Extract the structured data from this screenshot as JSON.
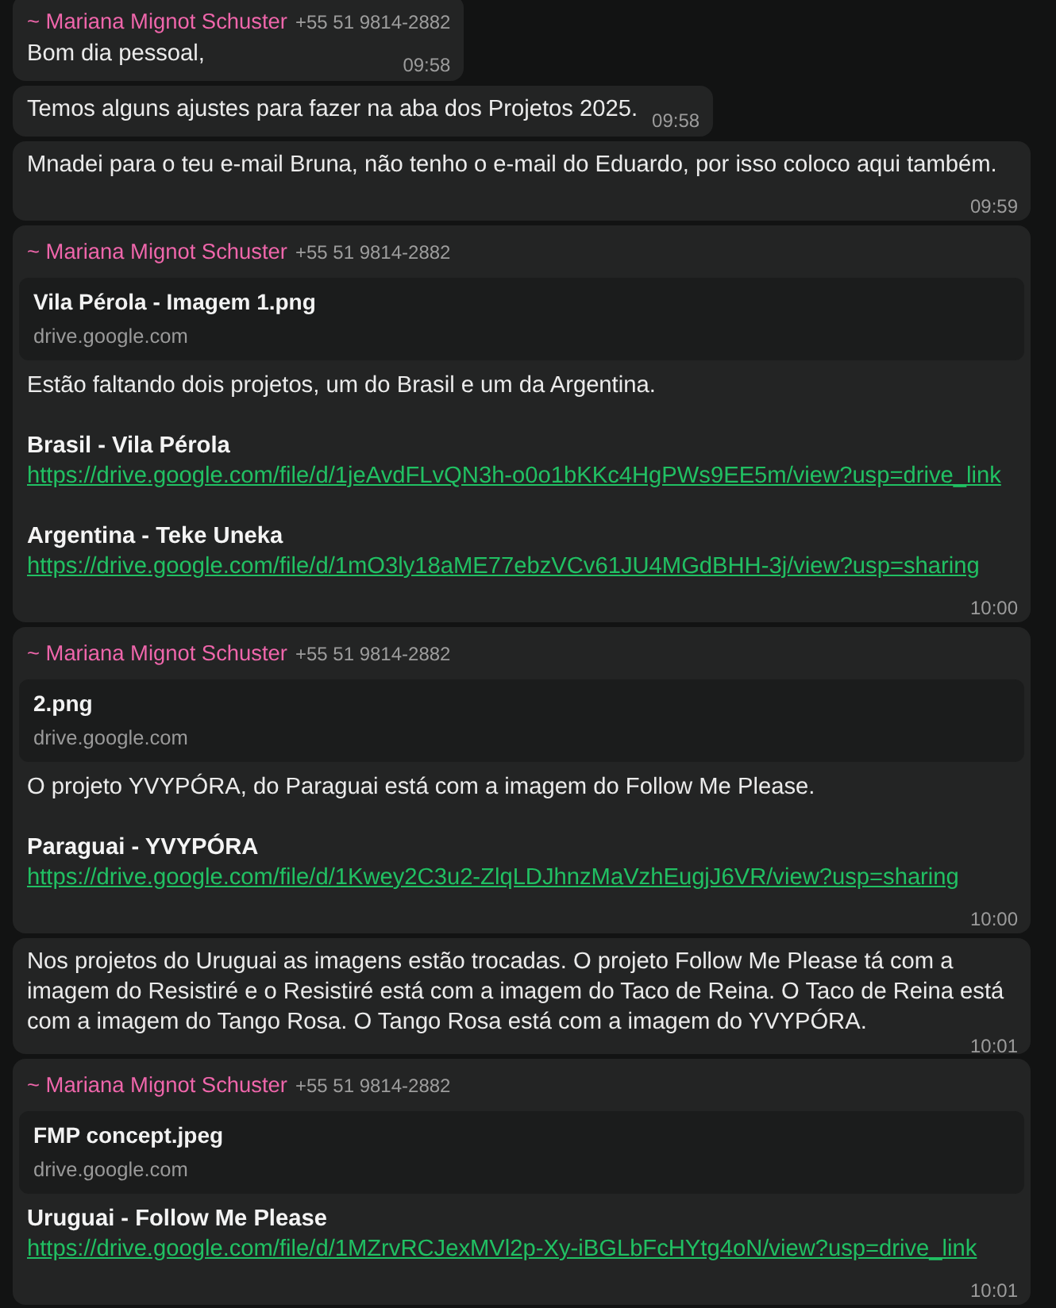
{
  "chat": {
    "messages": [
      {
        "sender": {
          "name": "~ Mariana Mignot Schuster",
          "phone": "+55 51 9814-2882"
        },
        "blocks": [
          {
            "kind": "paragraph",
            "text": "Bom dia pessoal,"
          }
        ],
        "time": "09:58"
      },
      {
        "blocks": [
          {
            "kind": "paragraph",
            "text": "Temos alguns ajustes para fazer na aba dos Projetos 2025."
          }
        ],
        "time": "09:58"
      },
      {
        "blocks": [
          {
            "kind": "paragraph",
            "text": "Mnadei para o teu e-mail Bruna, não tenho o e-mail do Eduardo, por isso coloco aqui também."
          }
        ],
        "time": "09:59"
      },
      {
        "sender": {
          "name": "~ Mariana Mignot Schuster",
          "phone": "+55 51 9814-2882"
        },
        "blocks": [
          {
            "kind": "preview",
            "title": "Vila Pérola - Imagem 1.png",
            "domain": "drive.google.com"
          },
          {
            "kind": "paragraph",
            "text": "Estão faltando dois projetos, um do Brasil e um da Argentina."
          },
          {
            "kind": "heading",
            "text": "Brasil - Vila Pérola"
          },
          {
            "kind": "link",
            "text": "https://drive.google.com/file/d/1jeAvdFLvQN3h-o0o1bKKc4HgPWs9EE5m/view?usp=drive_link"
          },
          {
            "kind": "heading",
            "text": "Argentina - Teke Uneka"
          },
          {
            "kind": "link",
            "text": "https://drive.google.com/file/d/1mO3ly18aME77ebzVCv61JU4MGdBHH-3j/view?usp=sharing"
          }
        ],
        "time": "10:00"
      },
      {
        "sender": {
          "name": "~ Mariana Mignot Schuster",
          "phone": "+55 51 9814-2882"
        },
        "blocks": [
          {
            "kind": "preview",
            "title": "2.png",
            "domain": "drive.google.com"
          },
          {
            "kind": "paragraph",
            "text": "O projeto YVYPÓRA, do Paraguai está com a imagem do Follow Me Please."
          },
          {
            "kind": "heading",
            "text": "Paraguai - YVYPÓRA"
          },
          {
            "kind": "link",
            "text": "https://drive.google.com/file/d/1Kwey2C3u2-ZlqLDJhnzMaVzhEugjJ6VR/view?usp=sharing"
          }
        ],
        "time": "10:00"
      },
      {
        "blocks": [
          {
            "kind": "paragraph",
            "text": "Nos projetos do Uruguai as imagens estão trocadas. O projeto Follow Me Please tá com a imagem do Resistiré e o Resistiré está com a imagem do Taco de Reina. O Taco de Reina está com a imagem do Tango Rosa. O Tango Rosa está com a imagem do YVYPÓRA."
          }
        ],
        "time": "10:01"
      },
      {
        "sender": {
          "name": "~ Mariana Mignot Schuster",
          "phone": "+55 51 9814-2882"
        },
        "blocks": [
          {
            "kind": "preview",
            "title": "FMP concept.jpeg",
            "domain": "drive.google.com"
          },
          {
            "kind": "heading",
            "text": "Uruguai - Follow Me Please"
          },
          {
            "kind": "link",
            "text": "https://drive.google.com/file/d/1MZrvRCJexMVl2p-Xy-iBGLbFcHYtg4oN/view?usp=drive_link"
          }
        ],
        "time": "10:01"
      }
    ]
  }
}
